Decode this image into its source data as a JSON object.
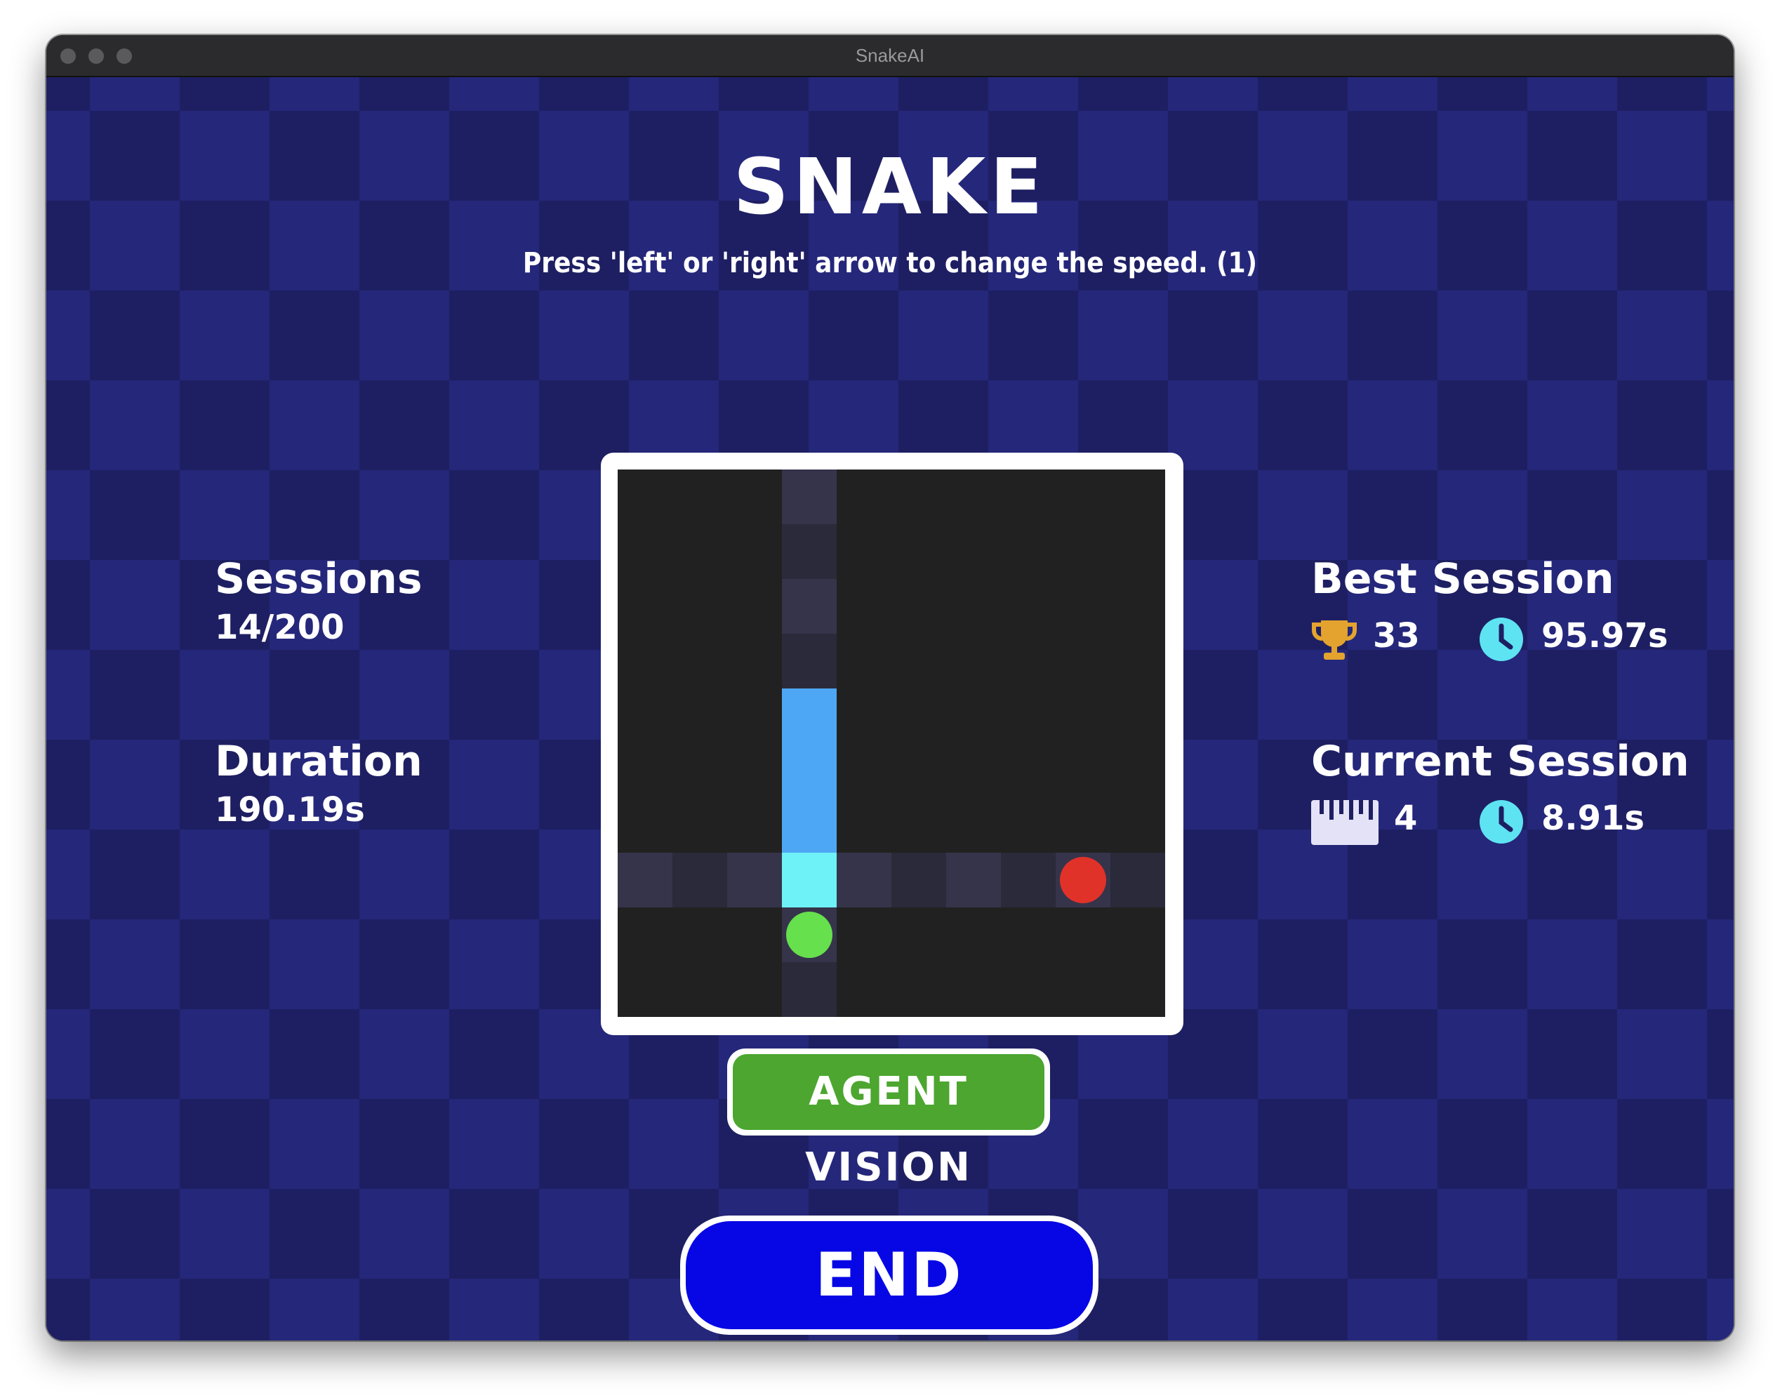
{
  "window": {
    "title": "SnakeAI"
  },
  "header": {
    "title": "SNAKE",
    "hint": "Press 'left' or 'right' arrow to change the speed. (1)"
  },
  "left_stats": {
    "sessions_label": "Sessions",
    "sessions_value": "14/200",
    "duration_label": "Duration",
    "duration_value": "190.19s"
  },
  "right_stats": {
    "best_label": "Best Session",
    "best_score": "33",
    "best_time": "95.97s",
    "current_label": "Current Session",
    "current_length": "4",
    "current_time": "8.91s"
  },
  "icons": {
    "best_score": "trophy-icon",
    "best_time": "clock-icon",
    "current_length": "ruler-icon",
    "current_time": "clock-icon"
  },
  "buttons": {
    "agent_vision": "AGENT VISION",
    "end_session": "END SESSION"
  },
  "board": {
    "grid_size": 10,
    "snake": [
      {
        "col": 3,
        "row": 4
      },
      {
        "col": 3,
        "row": 5
      },
      {
        "col": 3,
        "row": 6
      },
      {
        "col": 3,
        "row": 7
      }
    ],
    "snake_head": {
      "col": 3,
      "row": 7
    },
    "agent_food": {
      "col": 3,
      "row": 8
    },
    "enemy_food": {
      "col": 8,
      "row": 7
    },
    "vision_column": 3,
    "vision_row": 7
  },
  "colors": {
    "background": "#1e1f62",
    "checker": "#25277a",
    "board": "#212121",
    "vision_light": "#35344a",
    "vision_dark": "#2a2a3a",
    "snake_body": "#4ea7f5",
    "snake_head": "#6ef2f7",
    "green_food": "#66e04c",
    "red_food": "#e1322a",
    "vision_button": "#4ca62f",
    "end_button": "#0707e6",
    "trophy": "#e3a32e",
    "clock": "#5ee3f2",
    "ruler": "#e4e2f7"
  }
}
